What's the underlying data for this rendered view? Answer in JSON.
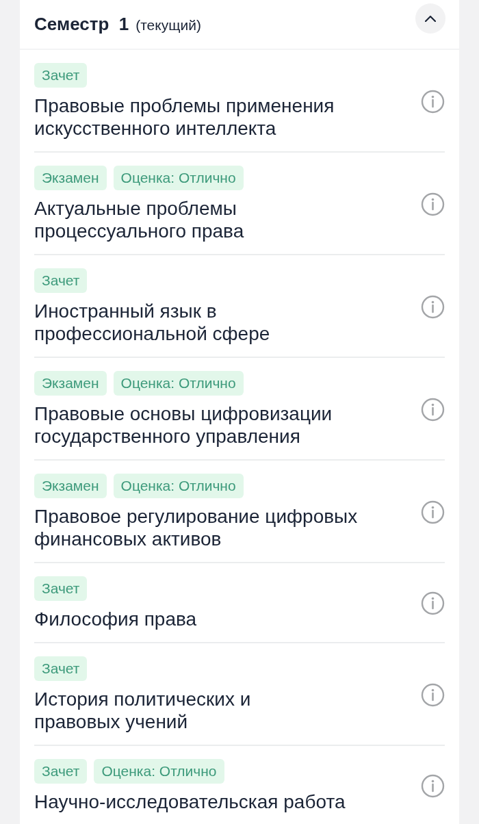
{
  "semester": {
    "title": "Семестр  1",
    "note": "(текущий)",
    "expanded": true
  },
  "subjects": [
    {
      "badges": [
        "Зачет"
      ],
      "title": "Правовые проблемы применения\nискусственного интеллекта"
    },
    {
      "badges": [
        "Экзамен",
        "Оценка: Отлично"
      ],
      "title": "Актуальные проблемы\nпроцессуального права"
    },
    {
      "badges": [
        "Зачет"
      ],
      "title": "Иностранный язык в\nпрофессиональной сфере"
    },
    {
      "badges": [
        "Экзамен",
        "Оценка: Отлично"
      ],
      "title": "Правовые основы цифровизации\nгосударственного управления"
    },
    {
      "badges": [
        "Экзамен",
        "Оценка: Отлично"
      ],
      "title": "Правовое регулирование цифровых\nфинансовых активов"
    },
    {
      "badges": [
        "Зачет"
      ],
      "title": "Философия права"
    },
    {
      "badges": [
        "Зачет"
      ],
      "title": "История политических и\nправовых учений"
    },
    {
      "badges": [
        "Зачет",
        "Оценка: Отлично"
      ],
      "title": "Научно-исследовательская работа"
    }
  ]
}
